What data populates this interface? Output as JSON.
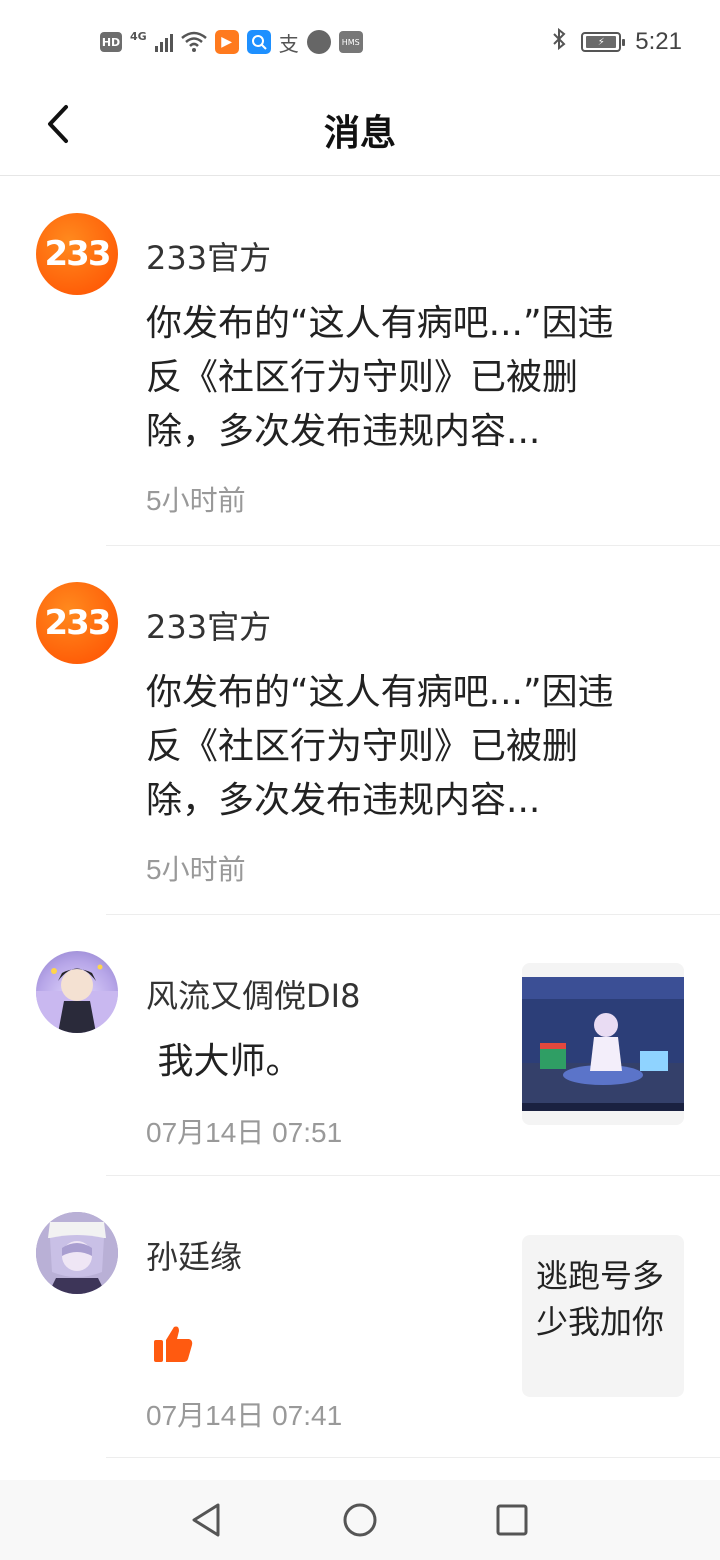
{
  "status_bar": {
    "hd": "HD",
    "network": "4G",
    "hms": "HMS",
    "time": "5:21"
  },
  "header": {
    "title": "消息"
  },
  "messages": [
    {
      "sender": "233官方",
      "avatar_text": "233",
      "content": "你发布的“这人有病吧...”因违反《社区行为守则》已被删除，多次发布违规内容...",
      "time": "5小时前"
    },
    {
      "sender": "233官方",
      "avatar_text": "233",
      "content": "你发布的“这人有病吧...”因违反《社区行为守则》已被删除，多次发布违规内容...",
      "time": "5小时前"
    },
    {
      "sender": "风流又倜傥DI8",
      "content": " 我大师。",
      "time": "07月14日 07:51"
    },
    {
      "sender": "孙廷缘",
      "time": "07月14日 07:41",
      "reply_preview": "逃跑号多少我加你"
    }
  ],
  "colors": {
    "accent": "#ff5a10",
    "text_secondary": "#999999",
    "divider": "#ededed"
  },
  "icons": {
    "back": "chevron-left-icon",
    "like": "thumbs-up-icon",
    "nav_back": "triangle-back-icon",
    "nav_home": "circle-home-icon",
    "nav_recent": "square-recent-icon"
  }
}
